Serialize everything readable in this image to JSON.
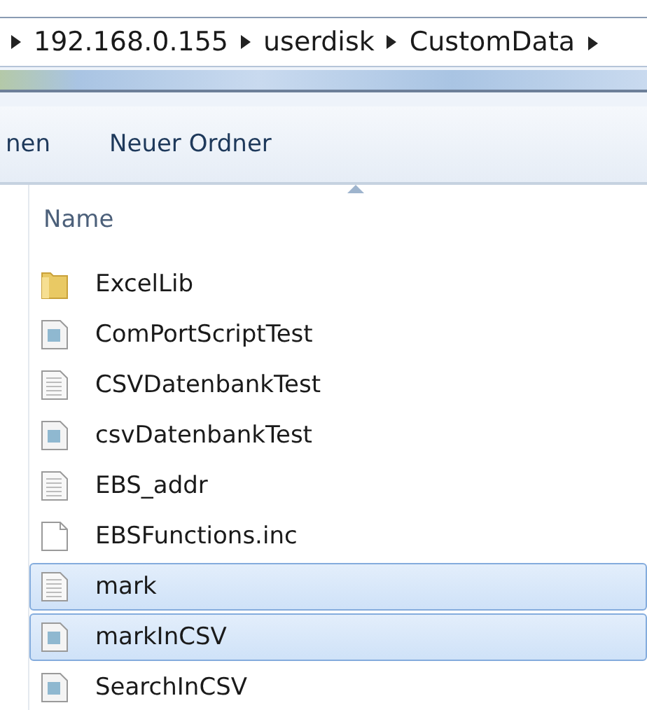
{
  "address_bar": {
    "crumbs": [
      "192.168.0.155",
      "userdisk",
      "CustomData"
    ]
  },
  "toolbar": {
    "items": [
      "nen",
      "Neuer Ordner"
    ]
  },
  "file_list": {
    "columns": [
      {
        "label": "Name",
        "sorted": true
      }
    ],
    "rows": [
      {
        "name": "ExcelLib",
        "kind": "folder",
        "selected": false
      },
      {
        "name": "ComPortScriptTest",
        "kind": "script",
        "selected": false
      },
      {
        "name": "CSVDatenbankTest",
        "kind": "text",
        "selected": false
      },
      {
        "name": "csvDatenbankTest",
        "kind": "script",
        "selected": false
      },
      {
        "name": "EBS_addr",
        "kind": "text",
        "selected": false
      },
      {
        "name": "EBSFunctions.inc",
        "kind": "blank",
        "selected": false
      },
      {
        "name": "mark",
        "kind": "text",
        "selected": true
      },
      {
        "name": "markInCSV",
        "kind": "script",
        "selected": true
      },
      {
        "name": "SearchInCSV",
        "kind": "script",
        "selected": false
      }
    ]
  }
}
